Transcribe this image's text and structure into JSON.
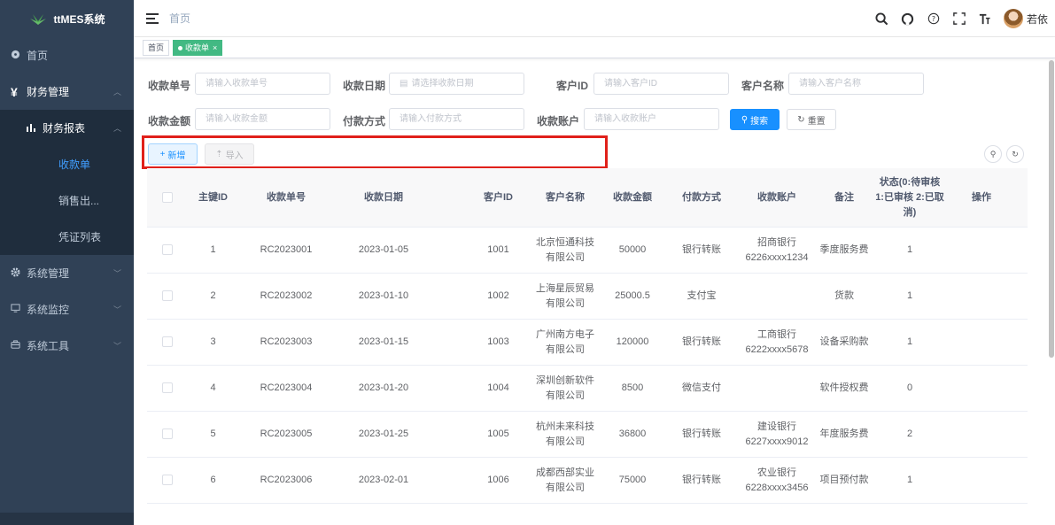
{
  "app": {
    "title": "ttMES系统",
    "user_name": "若依"
  },
  "sidebar": {
    "items": [
      {
        "label": "首页",
        "icon": "dashboard-icon"
      },
      {
        "label": "财务管理",
        "icon": "yen-icon"
      },
      {
        "label": "财务报表",
        "icon": "bar-chart-icon"
      },
      {
        "label": "收款单"
      },
      {
        "label": "销售出..."
      },
      {
        "label": "凭证列表"
      },
      {
        "label": "系统管理",
        "icon": "gear-icon"
      },
      {
        "label": "系统监控",
        "icon": "monitor-icon"
      },
      {
        "label": "系统工具",
        "icon": "toolbox-icon"
      }
    ]
  },
  "navbar": {
    "breadcrumb": "首页"
  },
  "tags": {
    "home": "首页",
    "current": "收款单",
    "close": "×"
  },
  "query": {
    "receipt_no": {
      "label": "收款单号",
      "placeholder": "请输入收款单号"
    },
    "receipt_date": {
      "label": "收款日期",
      "placeholder": "请选择收款日期"
    },
    "customer_id": {
      "label": "客户ID",
      "placeholder": "请输入客户ID"
    },
    "customer_name": {
      "label": "客户名称",
      "placeholder": "请输入客户名称"
    },
    "amount": {
      "label": "收款金额",
      "placeholder": "请输入收款金额"
    },
    "pay_method": {
      "label": "付款方式",
      "placeholder": "请输入付款方式"
    },
    "account": {
      "label": "收款账户",
      "placeholder": "请输入收款账户"
    },
    "search_label": "搜索",
    "reset_label": "重置"
  },
  "toolbar": {
    "add_label": "新增",
    "import_label": "导入"
  },
  "table": {
    "headers": [
      "主键ID",
      "收款单号",
      "收款日期",
      "客户ID",
      "客户名称",
      "收款金额",
      "付款方式",
      "收款账户",
      "备注",
      "状态(0:待审核 1:已审核 2:已取消)",
      "操作"
    ],
    "rows": [
      {
        "id": "1",
        "no": "RC2023001",
        "date": "2023-01-05",
        "cid": "1001",
        "cname": "北京恒通科技有限公司",
        "amount": "50000",
        "pay": "银行转账",
        "account": "招商银行 6226xxxx1234",
        "remark": "季度服务费",
        "status": "1"
      },
      {
        "id": "2",
        "no": "RC2023002",
        "date": "2023-01-10",
        "cid": "1002",
        "cname": "上海星辰贸易有限公司",
        "amount": "25000.5",
        "pay": "支付宝",
        "account": "",
        "remark": "货款",
        "status": "1"
      },
      {
        "id": "3",
        "no": "RC2023003",
        "date": "2023-01-15",
        "cid": "1003",
        "cname": "广州南方电子有限公司",
        "amount": "120000",
        "pay": "银行转账",
        "account": "工商银行 6222xxxx5678",
        "remark": "设备采购款",
        "status": "1"
      },
      {
        "id": "4",
        "no": "RC2023004",
        "date": "2023-01-20",
        "cid": "1004",
        "cname": "深圳创新软件有限公司",
        "amount": "8500",
        "pay": "微信支付",
        "account": "",
        "remark": "软件授权费",
        "status": "0"
      },
      {
        "id": "5",
        "no": "RC2023005",
        "date": "2023-01-25",
        "cid": "1005",
        "cname": "杭州未来科技有限公司",
        "amount": "36800",
        "pay": "银行转账",
        "account": "建设银行 6227xxxx9012",
        "remark": "年度服务费",
        "status": "2"
      },
      {
        "id": "6",
        "no": "RC2023006",
        "date": "2023-02-01",
        "cid": "1006",
        "cname": "成都西部实业有限公司",
        "amount": "75000",
        "pay": "银行转账",
        "account": "农业银行 6228xxxx3456",
        "remark": "项目预付款",
        "status": "1"
      }
    ]
  },
  "colors": {
    "sidebar_bg": "#304156",
    "accent": "#1890ff",
    "active_tag": "#42b983",
    "highlight_box": "#e0201a"
  }
}
